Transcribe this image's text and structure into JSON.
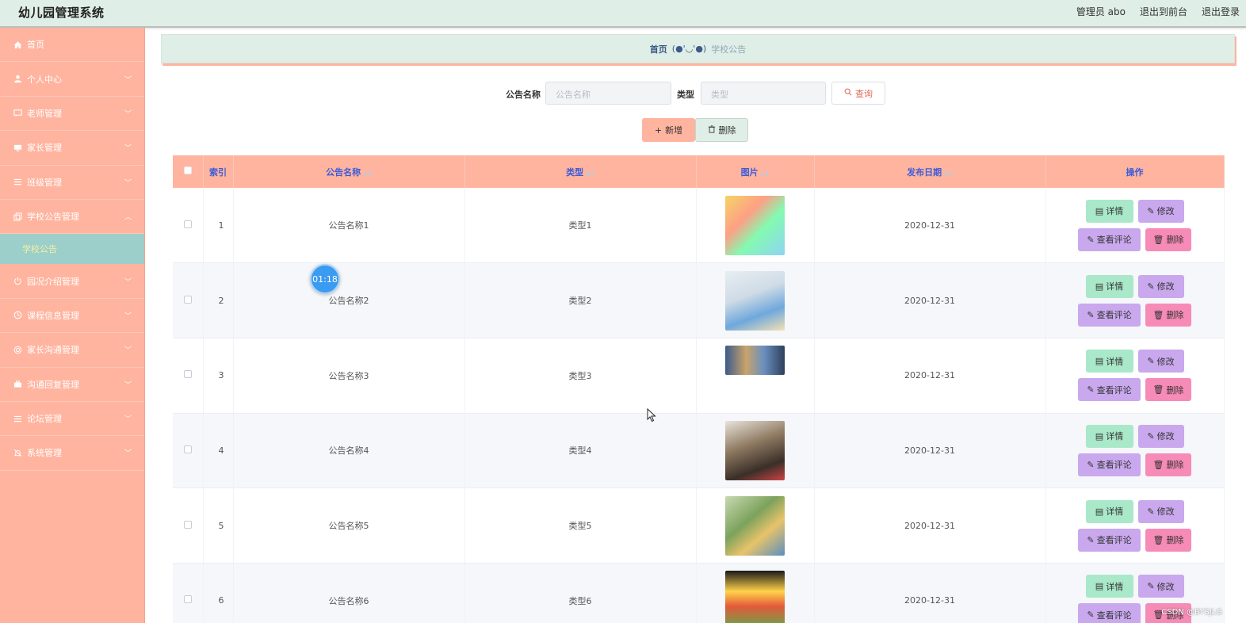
{
  "app": {
    "title": "幼儿园管理系统"
  },
  "header": {
    "user_label": "管理员 abo",
    "to_front": "退出到前台",
    "logout": "退出登录"
  },
  "sidebar": {
    "items": [
      {
        "label": "首页",
        "icon": "home-icon"
      },
      {
        "label": "个人中心",
        "icon": "user-icon"
      },
      {
        "label": "老师管理",
        "icon": "chat-icon"
      },
      {
        "label": "家长管理",
        "icon": "monitor-icon"
      },
      {
        "label": "班级管理",
        "icon": "list-icon"
      },
      {
        "label": "学校公告管理",
        "icon": "copy-icon",
        "expanded": true,
        "sub": "学校公告"
      },
      {
        "label": "园况介绍管理",
        "icon": "power-icon"
      },
      {
        "label": "课程信息管理",
        "icon": "clock-icon"
      },
      {
        "label": "家长沟通管理",
        "icon": "target-icon"
      },
      {
        "label": "沟通回复管理",
        "icon": "suitcase-icon"
      },
      {
        "label": "论坛管理",
        "icon": "list-icon"
      },
      {
        "label": "系统管理",
        "icon": "mute-bell-icon"
      }
    ]
  },
  "breadcrumb": {
    "home": "首页",
    "face": "(●'◡'●)",
    "current": "学校公告"
  },
  "search": {
    "name_label": "公告名称",
    "name_placeholder": "公告名称",
    "type_label": "类型",
    "type_placeholder": "类型",
    "query_label": "查询"
  },
  "actions": {
    "add_label": "新增",
    "delete_label": "删除"
  },
  "table": {
    "columns": [
      "索引",
      "公告名称",
      "类型",
      "图片",
      "发布日期",
      "操作"
    ],
    "rows": [
      {
        "index": "1",
        "name": "公告名称1",
        "type": "类型1",
        "date": "2020-12-31"
      },
      {
        "index": "2",
        "name": "公告名称2",
        "type": "类型2",
        "date": "2020-12-31"
      },
      {
        "index": "3",
        "name": "公告名称3",
        "type": "类型3",
        "date": "2020-12-31"
      },
      {
        "index": "4",
        "name": "公告名称4",
        "type": "类型4",
        "date": "2020-12-31"
      },
      {
        "index": "5",
        "name": "公告名称5",
        "type": "类型5",
        "date": "2020-12-31"
      },
      {
        "index": "6",
        "name": "公告名称6",
        "type": "类型6",
        "date": "2020-12-31"
      }
    ],
    "row_actions": {
      "detail": "详情",
      "edit": "修改",
      "comments": "查看评论",
      "delete": "删除"
    }
  },
  "overlay": {
    "timer": "01:18",
    "watermark": "CSDN @BYSJLG"
  },
  "colors": {
    "sidebar": "#ffb49f",
    "header": "#dfeee6",
    "active_sub": "#9ccfca",
    "detail": "#a9e8c9",
    "edit": "#c9a8ee",
    "remove": "#f78bb7"
  }
}
